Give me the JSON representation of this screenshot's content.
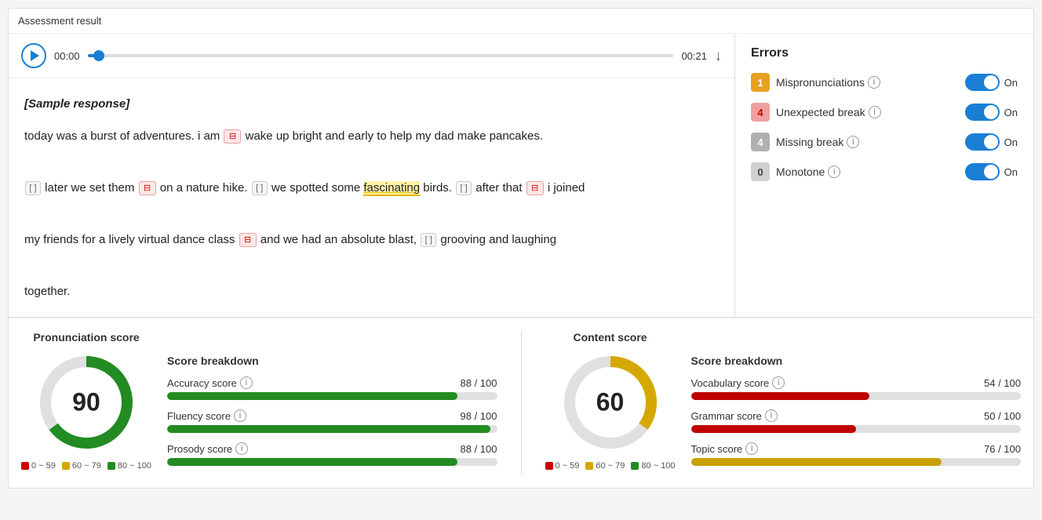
{
  "title": "Assessment result",
  "audio": {
    "time_start": "00:00",
    "time_end": "00:21"
  },
  "sample": {
    "label": "[Sample response]",
    "text_parts": [
      {
        "type": "text",
        "content": "today was a burst of adventures. i am "
      },
      {
        "type": "break_pink",
        "content": "⊟"
      },
      {
        "type": "text",
        "content": " wake up bright and early to help my dad make pancakes."
      },
      {
        "type": "newline"
      },
      {
        "type": "break_gray",
        "content": "[]"
      },
      {
        "type": "text",
        "content": " later we set them "
      },
      {
        "type": "break_pink",
        "content": "⊟"
      },
      {
        "type": "text",
        "content": " on a nature hike. "
      },
      {
        "type": "break_gray",
        "content": "[]"
      },
      {
        "type": "text",
        "content": " we spotted some "
      },
      {
        "type": "highlight",
        "content": "fascinating"
      },
      {
        "type": "text",
        "content": " birds. "
      },
      {
        "type": "break_gray",
        "content": "[]"
      },
      {
        "type": "text",
        "content": " after that "
      },
      {
        "type": "break_pink",
        "content": "⊟"
      },
      {
        "type": "text",
        "content": " i joined"
      },
      {
        "type": "newline"
      },
      {
        "type": "text",
        "content": "my friends for a lively virtual dance class "
      },
      {
        "type": "break_pink",
        "content": "⊟"
      },
      {
        "type": "text",
        "content": " and we had an absolute blast, "
      },
      {
        "type": "break_gray",
        "content": "[]"
      },
      {
        "type": "text",
        "content": " grooving and laughing"
      },
      {
        "type": "newline"
      },
      {
        "type": "text",
        "content": "together."
      }
    ]
  },
  "errors": {
    "title": "Errors",
    "items": [
      {
        "badge": "1",
        "badge_type": "orange",
        "label": "Mispronunciations",
        "toggle": "On"
      },
      {
        "badge": "4",
        "badge_type": "pink",
        "label": "Unexpected break",
        "toggle": "On"
      },
      {
        "badge": "4",
        "badge_type": "gray",
        "label": "Missing break",
        "toggle": "On"
      },
      {
        "badge": "0",
        "badge_type": "light",
        "label": "Monotone",
        "toggle": "On"
      }
    ]
  },
  "pronunciation": {
    "title": "Pronunciation score",
    "score": "90",
    "breakdown_title": "Score breakdown",
    "scores": [
      {
        "label": "Accuracy score",
        "value": "88 / 100",
        "pct": 88,
        "color": "green"
      },
      {
        "label": "Fluency score",
        "value": "98 / 100",
        "pct": 98,
        "color": "green"
      },
      {
        "label": "Prosody score",
        "value": "88 / 100",
        "pct": 88,
        "color": "green"
      }
    ],
    "legend": [
      {
        "range": "0 ~ 59",
        "color": "red"
      },
      {
        "range": "60 ~ 79",
        "color": "yellow"
      },
      {
        "range": "80 ~ 100",
        "color": "green"
      }
    ],
    "donut": {
      "score_pct": 90,
      "color": "#228b22",
      "bg_color": "#e0e0e0"
    }
  },
  "content": {
    "title": "Content score",
    "score": "60",
    "breakdown_title": "Score breakdown",
    "scores": [
      {
        "label": "Vocabulary score",
        "value": "54 / 100",
        "pct": 54,
        "color": "red"
      },
      {
        "label": "Grammar score",
        "value": "50 / 100",
        "pct": 50,
        "color": "red"
      },
      {
        "label": "Topic score",
        "value": "76 / 100",
        "pct": 76,
        "color": "yellow"
      }
    ],
    "legend": [
      {
        "range": "0 ~ 59",
        "color": "red"
      },
      {
        "range": "60 ~ 79",
        "color": "yellow"
      },
      {
        "range": "80 ~ 100",
        "color": "green"
      }
    ],
    "donut": {
      "score_pct": 60,
      "color": "#d4a800",
      "bg_color": "#e0e0e0"
    }
  }
}
